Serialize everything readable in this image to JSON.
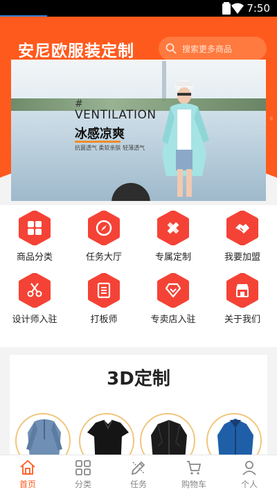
{
  "status_bar": {
    "time": "7:50"
  },
  "header": {
    "brand_title": "安尼欧服装定制",
    "search_placeholder": "搜索更多商品",
    "accent_color": "#ff5a1e"
  },
  "banner": {
    "hash": "#",
    "headline_en": "VENTILATION",
    "headline_cn": "冰感凉爽",
    "subline": "抗菌透气 柔软亲肤 轻薄透气"
  },
  "menu": {
    "items": [
      {
        "label": "商品分类",
        "icon": "grid-icon"
      },
      {
        "label": "任务大厅",
        "icon": "compass-icon"
      },
      {
        "label": "专属定制",
        "icon": "ruler-pencil-icon"
      },
      {
        "label": "我要加盟",
        "icon": "handshake-icon"
      },
      {
        "label": "设计师入驻",
        "icon": "scissors-icon"
      },
      {
        "label": "打板师",
        "icon": "document-icon"
      },
      {
        "label": "专卖店入驻",
        "icon": "diamond-icon"
      },
      {
        "label": "关于我们",
        "icon": "store-icon"
      }
    ]
  },
  "custom_3d": {
    "title": "3D定制"
  },
  "tab_bar": {
    "tabs": [
      {
        "label": "首页",
        "icon": "home-icon",
        "active": true
      },
      {
        "label": "分类",
        "icon": "category-icon",
        "active": false
      },
      {
        "label": "任务",
        "icon": "task-icon",
        "active": false
      },
      {
        "label": "购物车",
        "icon": "cart-icon",
        "active": false
      },
      {
        "label": "个人",
        "icon": "person-icon",
        "active": false
      }
    ]
  }
}
